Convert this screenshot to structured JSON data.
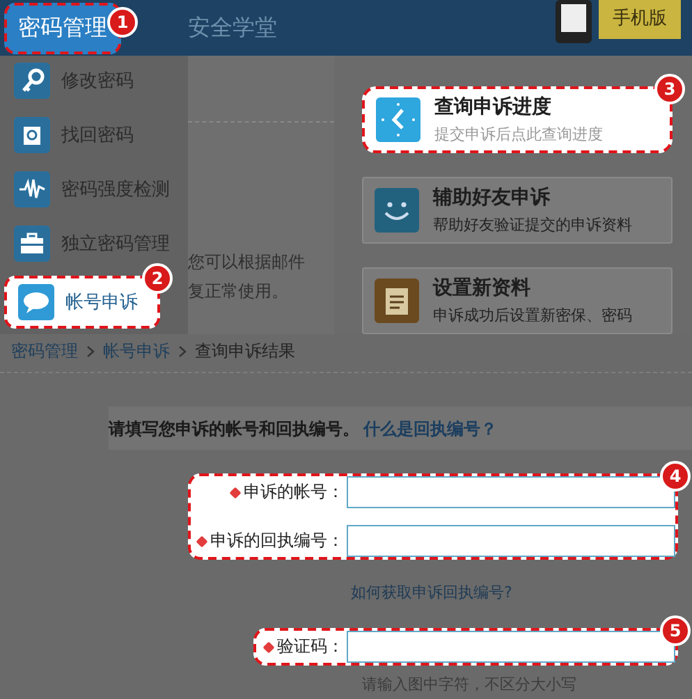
{
  "header": {
    "tabs": [
      {
        "label": "密码管理",
        "selected": true,
        "badge": "1"
      },
      {
        "label": "安全学堂",
        "selected": false
      }
    ],
    "promo": {
      "label": "手机版"
    }
  },
  "menu": {
    "items": [
      {
        "label": "修改密码",
        "kind": "key",
        "selected": false
      },
      {
        "label": "找回密码",
        "kind": "doc",
        "selected": false
      },
      {
        "label": "密码强度检测",
        "kind": "wave",
        "selected": false
      },
      {
        "label": "独立密码管理",
        "kind": "case",
        "selected": false
      },
      {
        "label": "帐号申诉",
        "kind": "chat",
        "selected": true,
        "badge": "2"
      }
    ]
  },
  "intro_fragments": [
    "您可以根据邮件",
    "复正常使用。"
  ],
  "cards": [
    {
      "title": "查询申诉进度",
      "subtitle": "提交申诉后点此查询进度",
      "kind": "clock",
      "selected": true,
      "badge": "3"
    },
    {
      "title": "辅助好友申诉",
      "subtitle": "帮助好友验证提交的申诉资料",
      "kind": "smile",
      "selected": false
    },
    {
      "title": "设置新资料",
      "subtitle": "申诉成功后设置新密保、密码",
      "kind": "note",
      "selected": false
    }
  ],
  "breadcrumb": [
    "密码管理",
    "帐号申诉",
    "查询申诉结果"
  ],
  "form": {
    "prompt": "请填写您申诉的帐号和回执编号。",
    "help_link": "什么是回执编号？",
    "groups": [
      {
        "badge": "4",
        "fields": [
          {
            "label": "申诉的帐号：",
            "required": true
          },
          {
            "label": "申诉的回执编号：",
            "required": true
          }
        ]
      },
      {
        "badge": "5",
        "fields": [
          {
            "label": "验证码：",
            "required": true
          }
        ]
      }
    ],
    "receipt_link": "如何获取申诉回执编号?",
    "captcha_hint": "请输入图中字符，不区分大小写"
  }
}
